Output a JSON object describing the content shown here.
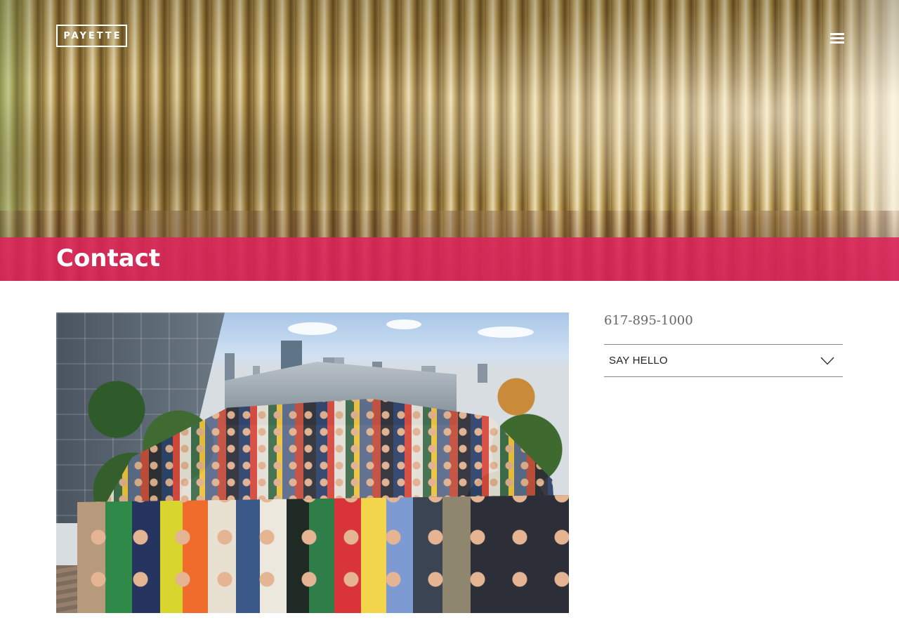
{
  "header": {
    "logo_text": "PAYETTE",
    "menu_icon": "hamburger-menu-icon"
  },
  "hero": {
    "title": "Contact",
    "band_color": "#dd235a"
  },
  "main": {
    "team_photo": "group-photo",
    "phone": "617-895-1000",
    "say_hello": {
      "label": "SAY HELLO",
      "icon": "chevron-down-icon"
    }
  }
}
